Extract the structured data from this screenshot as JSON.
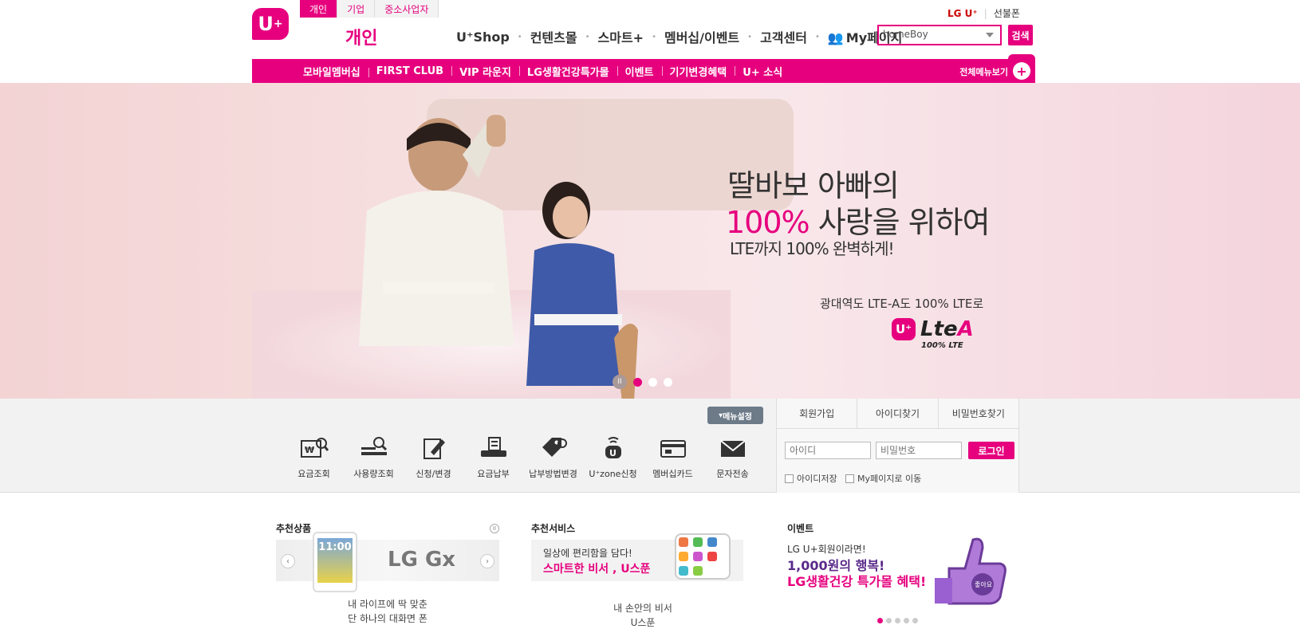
{
  "header": {
    "logo_text": "U",
    "logo_sup": "+",
    "segments": [
      "개인",
      "기업",
      "중소사업자"
    ],
    "section_title": "개인",
    "nav": [
      "U⁺Shop",
      "컨텐츠몰",
      "스마트+",
      "멤버십/이벤트",
      "고객센터",
      "My페이지"
    ],
    "top_links": {
      "brand": "LG U⁺",
      "gift": "선불폰"
    },
    "search_value": "homeBoy",
    "search_button": "검색"
  },
  "subnav": {
    "items": [
      "모바일멤버십",
      "FIRST CLUB",
      "VIP 라운지",
      "LG생활건강특가몰",
      "이벤트",
      "기기변경혜택",
      "U+ 소식"
    ],
    "all_menu": "전체메뉴보기",
    "plus": "+"
  },
  "hero": {
    "line1": "딸바보 아빠의",
    "line2_pct": "100%",
    "line2_rest": " 사랑을 위하여",
    "line3": "LTE까지 100% 완벽하게!",
    "line4": "광대역도 LTE-A도 100% LTE로",
    "logo_u": "U⁺",
    "logo_lte": "Lte",
    "logo_a": "A",
    "logo_sub": "100% LTE",
    "pause": "II",
    "active_slide": 1
  },
  "quick": {
    "menu_setting": "메뉴설정",
    "items": [
      {
        "label": "요금조회",
        "icon": "bill-icon"
      },
      {
        "label": "사용량조회",
        "icon": "usage-icon"
      },
      {
        "label": "신청/변경",
        "icon": "edit-icon"
      },
      {
        "label": "요금납부",
        "icon": "payment-icon"
      },
      {
        "label": "납부방법변경",
        "icon": "tag-icon"
      },
      {
        "label": "U⁺zone신청",
        "icon": "wifi-icon"
      },
      {
        "label": "멤버십카드",
        "icon": "card-icon"
      },
      {
        "label": "문자전송",
        "icon": "mail-icon"
      }
    ]
  },
  "login": {
    "tabs": [
      "회원가입",
      "아이디찾기",
      "비밀번호찾기"
    ],
    "id_placeholder": "아이디",
    "pw_placeholder": "비밀번호",
    "button": "로그인",
    "save_id": "아이디저장",
    "go_mypage": "My페이지로 이동"
  },
  "bottom": {
    "rec_product": {
      "title": "추천상품",
      "phone_time": "11:00",
      "brand": "LG Gx",
      "caption1": "내 라이프에 딱 맞춘",
      "caption2": "단 하나의 대화면 폰",
      "pause": "II",
      "prev": "‹",
      "next": "›"
    },
    "rec_service": {
      "title": "추천서비스",
      "line1": "일상에 편리함을 담다!",
      "line2": "스마트한 비서 , U스푼",
      "caption1": "내 손안의 비서",
      "caption2": "U스푼"
    },
    "event": {
      "title": "이벤트",
      "line1": "LG U+회원이라면!",
      "line2": "1,000원의 행복!",
      "line3": "LG생활건강 특가몰 혜택!",
      "like": "좋아요",
      "dots": 5,
      "active": 0
    }
  },
  "colors": {
    "brand": "#e6007e",
    "navy": "#5a2a8a"
  }
}
